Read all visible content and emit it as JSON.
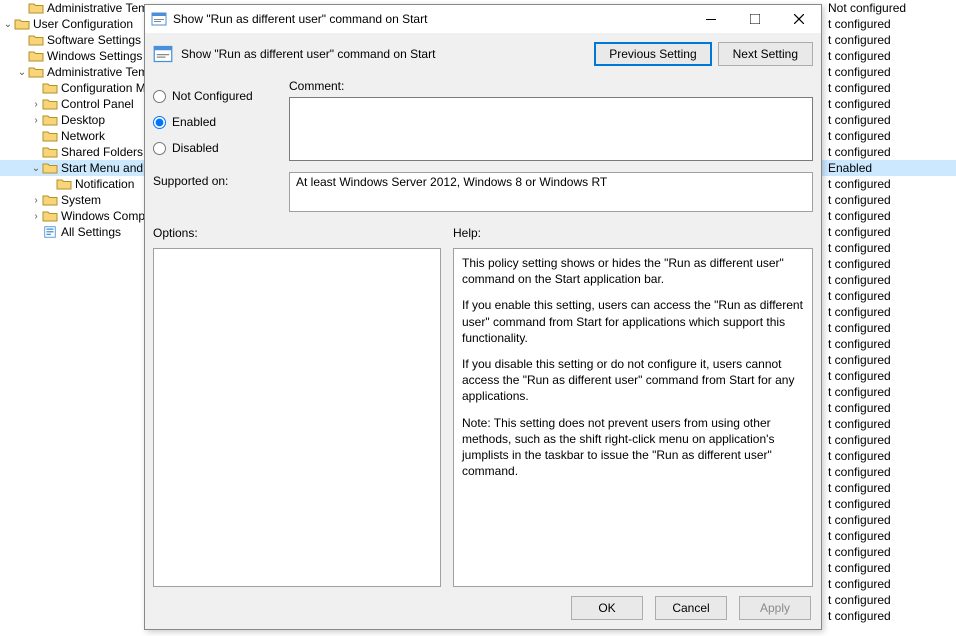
{
  "dialog": {
    "title": "Show \"Run as different user\" command on Start",
    "subtitle": "Show \"Run as different user\" command on Start",
    "previous_button": "Previous Setting",
    "next_button": "Next Setting",
    "radio": {
      "not_configured": "Not Configured",
      "enabled": "Enabled",
      "disabled": "Disabled",
      "selected": "enabled"
    },
    "comment_label": "Comment:",
    "comment_value": "",
    "supported_label": "Supported on:",
    "supported_value": "At least Windows Server 2012, Windows 8 or Windows RT",
    "options_label": "Options:",
    "help_label": "Help:",
    "help_paragraphs": [
      "This policy setting shows or hides the \"Run as different user\" command on the Start application bar.",
      "If you enable this setting, users can access the \"Run as different user\" command from Start for applications which support this functionality.",
      "If you disable this setting or do not configure it, users cannot access the \"Run as different user\" command from Start for any applications.",
      "Note: This setting does not prevent users from using other methods, such as the shift right-click menu on application's jumplists in the taskbar to issue the \"Run as different user\" command."
    ],
    "ok_button": "OK",
    "cancel_button": "Cancel",
    "apply_button": "Apply"
  },
  "tree": [
    {
      "indent": 1,
      "toggle": "",
      "icon": "folder",
      "label": "Administrative Templ"
    },
    {
      "indent": 0,
      "toggle": "v",
      "icon": "folder",
      "label": "User Configuration"
    },
    {
      "indent": 1,
      "toggle": "",
      "icon": "folder",
      "label": "Software Settings"
    },
    {
      "indent": 1,
      "toggle": "",
      "icon": "folder",
      "label": "Windows Settings"
    },
    {
      "indent": 1,
      "toggle": "v",
      "icon": "folder",
      "label": "Administrative Templ"
    },
    {
      "indent": 2,
      "toggle": "",
      "icon": "folder-y",
      "label": "Configuration M"
    },
    {
      "indent": 2,
      "toggle": ">",
      "icon": "folder-y",
      "label": "Control Panel"
    },
    {
      "indent": 2,
      "toggle": ">",
      "icon": "folder-y",
      "label": "Desktop"
    },
    {
      "indent": 2,
      "toggle": "",
      "icon": "folder-y",
      "label": "Network"
    },
    {
      "indent": 2,
      "toggle": "",
      "icon": "folder-y",
      "label": "Shared Folders"
    },
    {
      "indent": 2,
      "toggle": "v",
      "icon": "folder-y",
      "label": "Start Menu and",
      "selected": true
    },
    {
      "indent": 3,
      "toggle": "",
      "icon": "folder-y",
      "label": "Notification"
    },
    {
      "indent": 2,
      "toggle": ">",
      "icon": "folder-y",
      "label": "System"
    },
    {
      "indent": 2,
      "toggle": ">",
      "icon": "folder-y",
      "label": "Windows Comp"
    },
    {
      "indent": 2,
      "toggle": "",
      "icon": "settings",
      "label": "All Settings"
    }
  ],
  "settings_column": {
    "rows": [
      "Not configured",
      "t configured",
      "t configured",
      "t configured",
      "t configured",
      "t configured",
      "t configured",
      "t configured",
      "t configured",
      "t configured"
    ],
    "highlighted_row": {
      "text": "Enabled"
    },
    "after_rows": [
      "t configured",
      "t configured",
      "t configured",
      "t configured",
      "t configured",
      "t configured",
      "t configured",
      "t configured",
      "t configured",
      "t configured",
      "t configured",
      "t configured",
      "t configured",
      "t configured",
      "t configured",
      "t configured",
      "t configured",
      "t configured",
      "t configured",
      "t configured",
      "t configured",
      "t configured",
      "t configured",
      "t configured",
      "t configured",
      "t configured",
      "t configured",
      "t configured"
    ]
  },
  "icons": {
    "folder": "folder-icon",
    "settings": "settings-icon",
    "minimize": "minimize-icon",
    "maximize": "maximize-icon",
    "close": "close-icon",
    "policy": "policy-icon"
  }
}
